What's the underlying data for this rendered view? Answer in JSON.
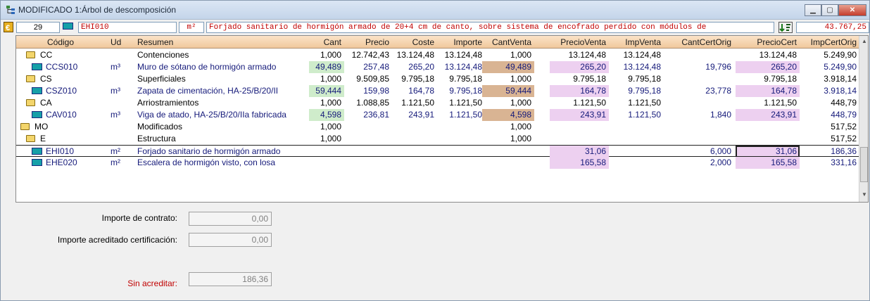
{
  "window": {
    "title": "MODIFICADO 1:Árbol de descomposición"
  },
  "toolbar": {
    "count": "29",
    "code": "EHI010",
    "unit": "m²",
    "description": "Forjado sanitario de hormigón armado de 20+4 cm de canto, sobre sistema de encofrado perdido con módulos de",
    "total": "43.767,25"
  },
  "columns": [
    "Código",
    "Ud",
    "Resumen",
    "Cant",
    "Precio",
    "Coste",
    "Importe",
    "CantVenta",
    "PrecioVenta",
    "ImpVenta",
    "CantCertOrig",
    "PrecioCert",
    "ImpCertOrig"
  ],
  "rows": [
    {
      "code": "CC",
      "ud": "",
      "resumen": "Contenciones",
      "cant": "1,000",
      "precio": "12.742,43",
      "coste": "13.124,48",
      "importe": "13.124,48",
      "cantventa": "1,000",
      "precioventa": "13.124,48",
      "impventa": "13.124,48",
      "cantcert": "",
      "preciocert": "13.124,48",
      "impcert": "5.249,90"
    },
    {
      "code": "CCS010",
      "ud": "m³",
      "resumen": "Muro de sótano de hormigón armado",
      "cant": "49,489",
      "precio": "257,48",
      "coste": "265,20",
      "importe": "13.124,48",
      "cantventa": "49,489",
      "precioventa": "265,20",
      "impventa": "13.124,48",
      "cantcert": "19,796",
      "preciocert": "265,20",
      "impcert": "5.249,90"
    },
    {
      "code": "CS",
      "ud": "",
      "resumen": "Superficiales",
      "cant": "1,000",
      "precio": "9.509,85",
      "coste": "9.795,18",
      "importe": "9.795,18",
      "cantventa": "1,000",
      "precioventa": "9.795,18",
      "impventa": "9.795,18",
      "cantcert": "",
      "preciocert": "9.795,18",
      "impcert": "3.918,14"
    },
    {
      "code": "CSZ010",
      "ud": "m³",
      "resumen": "Zapata de cimentación, HA-25/B/20/II",
      "cant": "59,444",
      "precio": "159,98",
      "coste": "164,78",
      "importe": "9.795,18",
      "cantventa": "59,444",
      "precioventa": "164,78",
      "impventa": "9.795,18",
      "cantcert": "23,778",
      "preciocert": "164,78",
      "impcert": "3.918,14"
    },
    {
      "code": "CA",
      "ud": "",
      "resumen": "Arriostramientos",
      "cant": "1,000",
      "precio": "1.088,85",
      "coste": "1.121,50",
      "importe": "1.121,50",
      "cantventa": "1,000",
      "precioventa": "1.121,50",
      "impventa": "1.121,50",
      "cantcert": "",
      "preciocert": "1.121,50",
      "impcert": "448,79"
    },
    {
      "code": "CAV010",
      "ud": "m³",
      "resumen": "Viga de atado, HA-25/B/20/IIa fabricada",
      "cant": "4,598",
      "precio": "236,81",
      "coste": "243,91",
      "importe": "1.121,50",
      "cantventa": "4,598",
      "precioventa": "243,91",
      "impventa": "1.121,50",
      "cantcert": "1,840",
      "preciocert": "243,91",
      "impcert": "448,79"
    },
    {
      "code": "MO",
      "ud": "",
      "resumen": "Modificados",
      "cant": "1,000",
      "precio": "",
      "coste": "",
      "importe": "",
      "cantventa": "1,000",
      "precioventa": "",
      "impventa": "",
      "cantcert": "",
      "preciocert": "",
      "impcert": "517,52"
    },
    {
      "code": "E",
      "ud": "",
      "resumen": "Estructura",
      "cant": "1,000",
      "precio": "",
      "coste": "",
      "importe": "",
      "cantventa": "1,000",
      "precioventa": "",
      "impventa": "",
      "cantcert": "",
      "preciocert": "",
      "impcert": "517,52"
    },
    {
      "code": "EHI010",
      "ud": "m²",
      "resumen": "Forjado sanitario de hormigón armado",
      "cant": "",
      "precio": "",
      "coste": "",
      "importe": "",
      "cantventa": "",
      "precioventa": "31,06",
      "impventa": "",
      "cantcert": "6,000",
      "preciocert": "31,06",
      "impcert": "186,36"
    },
    {
      "code": "EHE020",
      "ud": "m²",
      "resumen": "Escalera de hormigón visto, con losa",
      "cant": "",
      "precio": "",
      "coste": "",
      "importe": "",
      "cantventa": "",
      "precioventa": "165,58",
      "impventa": "",
      "cantcert": "2,000",
      "preciocert": "165,58",
      "impcert": "331,16"
    }
  ],
  "summary": {
    "contrato_label": "Importe de contrato:",
    "contrato_value": "0,00",
    "acreditado_label": "Importe acreditado certificación:",
    "acreditado_value": "0,00",
    "sin_label": "Sin acreditar:",
    "sin_value": "186,36"
  },
  "colors": {
    "header": "#f0c89c",
    "green": "#cfeccb",
    "tan": "#d9b493",
    "pink": "#edd0f0",
    "navy": "#151a7a",
    "red": "#c00000"
  }
}
